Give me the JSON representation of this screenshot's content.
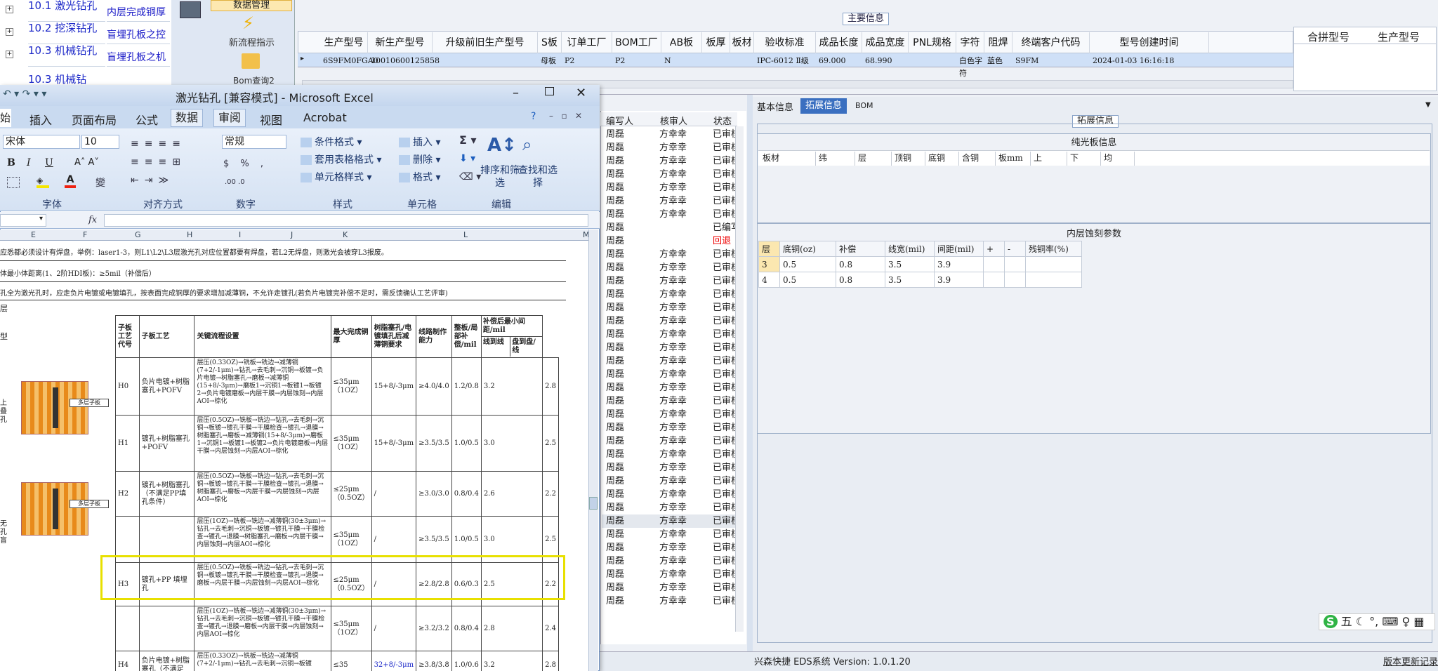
{
  "left_tree": {
    "items": [
      {
        "id": "10.1",
        "name": "激光钻孔",
        "desc": "内层完成铜厚"
      },
      {
        "id": "10.2",
        "name": "挖深钻孔",
        "desc": "盲埋孔板之控"
      },
      {
        "id": "10.3",
        "name": "机械钻孔",
        "desc": "盲埋孔板之机"
      },
      {
        "id": "10.3",
        "name": "机械钻",
        "desc": ""
      }
    ]
  },
  "toolbar_left": {
    "data_mgmt": "数据管理",
    "new_guide": "新流程指示",
    "bom_query": "Bom查询2"
  },
  "main_info": {
    "section_title": "主要信息",
    "columns": [
      "生产型号",
      "新生产型号",
      "升级前旧生产型号",
      "S板",
      "订单工厂",
      "BOM工厂",
      "AB板",
      "板厚",
      "板材",
      "验收标准",
      "成品长度",
      "成品宽度",
      "PNL规格",
      "字符",
      "阻焊",
      "终端客户代码",
      "型号创建时间"
    ],
    "row": [
      "6S9FM0FGA0",
      "10010600125858",
      "",
      "母板",
      "P2",
      "P2",
      "N",
      "",
      "",
      "IPC-6012 Ⅱ级",
      "69.000",
      "68.990",
      "",
      "白色字符",
      "蓝色",
      "S9FM",
      "2024-01-03 16:16:18"
    ],
    "side_columns": [
      "合拼型号",
      "生产型号"
    ]
  },
  "excel": {
    "title": "激光钻孔 [兼容模式] - Microsoft Excel",
    "tabs": [
      "始",
      "插入",
      "页面布局",
      "公式",
      "数据",
      "审阅",
      "视图",
      "Acrobat"
    ],
    "font_name": "宋体",
    "font_size": "10",
    "number_format": "常规",
    "groups": [
      "字体",
      "对齐方式",
      "数字",
      "样式",
      "单元格",
      "编辑"
    ],
    "style_btns": [
      "条件格式",
      "套用表格格式",
      "单元格样式"
    ],
    "cell_btns": [
      "插入",
      "删除",
      "格式"
    ],
    "edit_btns": [
      "排序和筛选",
      "查找和选择"
    ],
    "fx": "fx",
    "col_letters": [
      "E",
      "F",
      "G",
      "H",
      "I",
      "J",
      "K",
      "L",
      "M"
    ],
    "note1": "应悉都必须设计有焊盘，举例：laser1-3，则L1\\L2\\L3层激光孔对应位置都要有焊盘，若L2无焊盘，则激光会被穿L3报废。",
    "note2": "体最小体距离(1、2阶HDI板)：≥5mil（补偿后）",
    "note3": "孔全为激光孔时，应走负片电镀或电镀填孔，按表面完成铜厚的要求增加减薄铜，不允许走镀孔(若负片电镀完补偿不足时，需反馈确认工艺评审)",
    "note4": "层",
    "table_headers": [
      "子板工艺代号",
      "子板工艺",
      "关键流程设置",
      "最大完成铜厚",
      "树脂塞孔/电镀填孔后减薄铜要求",
      "线路制作能力",
      "整板/局部补偿/mil",
      "补偿后最小间距/mil",
      "线到线",
      "盘到盘/线"
    ],
    "rows": [
      {
        "code": "H0",
        "proc": "负片电镀+树脂塞孔+POFV",
        "flow": "层压(0.33OZ)→铣板→铣边→减薄铜(7+2/-1μm)→钻孔→去毛刺→沉铜→板镀→负片电镀→树脂塞孔→磨板→减薄铜(15+8/-3μm)→磨板1→沉铜1→板镀1→板镀2→负片电镀磨板→内层干膜→内层蚀刻→内层AOI→棕化",
        "cu": "≤35μm（1OZ）",
        "thin": "15+8/-3μm",
        "line": "≥4.0/4.0",
        "comp": "1.2/0.8",
        "ll": "3.2",
        "pp": "2.8"
      },
      {
        "code": "H1",
        "proc": "镀孔+树脂塞孔+POFV",
        "flow": "层压(0.5OZ)→铣板→铣边→钻孔→去毛刺→沉铜→板镀→镀孔干膜→干膜检查→镀孔→退膜→树脂塞孔→磨板→减薄铜(15+8/-3μm)→磨板1→沉铜1→板镀1→板镀2→负片电镀磨板→内层干膜→内层蚀刻→内层AOI→棕化",
        "cu": "≤35μm（1OZ）",
        "thin": "15+8/-3μm",
        "line": "≥3.5/3.5",
        "comp": "1.0/0.5",
        "ll": "3.0",
        "pp": "2.5"
      },
      {
        "code": "H2",
        "proc": "镀孔+树脂塞孔（不满足PP填孔条件）",
        "flow": "层压(0.5OZ)→铣板→铣边→钻孔→去毛刺→沉铜→板镀→镀孔干膜→干膜检查→镀孔→退膜→树脂塞孔→磨板→内层干膜→内层蚀刻→内层AOI→棕化",
        "cu": "≤25μm（0.5OZ）",
        "thin": "/",
        "line": "≥3.0/3.0",
        "comp": "0.8/0.4",
        "ll": "2.6",
        "pp": "2.2"
      },
      {
        "code": "",
        "proc": "",
        "flow": "层压(1OZ)→铣板→铣边→减薄铜(30±3μm)→钻孔→去毛刺→沉铜→板镀→镀孔干膜→干膜检查→镀孔→退膜→树脂塞孔→磨板→内层干膜→内层蚀刻→内层AOI→棕化",
        "cu": "≤35μm（1OZ）",
        "thin": "/",
        "line": "≥3.5/3.5",
        "comp": "1.0/0.5",
        "ll": "3.0",
        "pp": "2.5"
      },
      {
        "code": "H3",
        "proc": "镀孔+PP 填埋孔",
        "flow": "层压(0.5OZ)→铣板→铣边→钻孔→去毛刺→沉铜→板镀→镀孔干膜→干膜检查→镀孔→退膜→磨板→内层干膜→内层蚀刻→内层AOI→棕化",
        "cu": "≤25μm（0.5OZ）",
        "thin": "/",
        "line": "≥2.8/2.8",
        "comp": "0.6/0.3",
        "ll": "2.5",
        "pp": "2.2"
      },
      {
        "code": "",
        "proc": "",
        "flow": "层压(1OZ)→铣板→铣边→减薄铜(30±3μm)→钻孔→去毛刺→沉铜→板镀→镀孔干膜→干膜检查→镀孔→退膜→磨板→内层干膜→内层蚀刻→内层AOI→棕化",
        "cu": "≤35μm（1OZ）",
        "thin": "/",
        "line": "≥3.2/3.2",
        "comp": "0.8/0.4",
        "ll": "2.8",
        "pp": "2.4"
      },
      {
        "code": "H4",
        "proc": "负片电镀+树脂塞孔（不满足",
        "flow": "层压(0.33OZ)→铣板→铣边→减薄铜(7+2/-1μm)→钻孔→去毛刺→沉铜→板镀",
        "cu": "≤35",
        "thin": "32+8/-3μm",
        "line": "≥3.8/3.8",
        "comp": "1.0/0.6",
        "ll": "3.2",
        "pp": "2.8"
      }
    ],
    "img_label": "多层子板",
    "side_labels": [
      "上叠孔",
      "无孔盲"
    ]
  },
  "list": {
    "headers": [
      "编写人",
      "核审人",
      "状态"
    ],
    "rows": [
      [
        "周磊",
        "方幸幸",
        "已审核"
      ],
      [
        "周磊",
        "方幸幸",
        "已审核"
      ],
      [
        "周磊",
        "方幸幸",
        "已审核"
      ],
      [
        "周磊",
        "方幸幸",
        "已审核"
      ],
      [
        "周磊",
        "方幸幸",
        "已审核"
      ],
      [
        "周磊",
        "方幸幸",
        "已审核"
      ],
      [
        "周磊",
        "方幸幸",
        "已审核"
      ],
      [
        "周磊",
        "",
        "已编写"
      ],
      [
        "周磊",
        "",
        "回退"
      ],
      [
        "周磊",
        "方幸幸",
        "已审核"
      ],
      [
        "周磊",
        "方幸幸",
        "已审核"
      ],
      [
        "周磊",
        "方幸幸",
        "已审核"
      ],
      [
        "周磊",
        "方幸幸",
        "已审核"
      ],
      [
        "周磊",
        "方幸幸",
        "已审核"
      ],
      [
        "周磊",
        "方幸幸",
        "已审核"
      ],
      [
        "周磊",
        "方幸幸",
        "已审核"
      ],
      [
        "周磊",
        "方幸幸",
        "已审核"
      ],
      [
        "周磊",
        "方幸幸",
        "已审核"
      ],
      [
        "周磊",
        "方幸幸",
        "已审核"
      ],
      [
        "周磊",
        "方幸幸",
        "已审核"
      ],
      [
        "周磊",
        "方幸幸",
        "已审核"
      ],
      [
        "周磊",
        "方幸幸",
        "已审核"
      ],
      [
        "周磊",
        "方幸幸",
        "已审核"
      ],
      [
        "周磊",
        "方幸幸",
        "已审核"
      ],
      [
        "周磊",
        "方幸幸",
        "已审核"
      ],
      [
        "周磊",
        "方幸幸",
        "已审核"
      ],
      [
        "周磊",
        "方幸幸",
        "已审核"
      ],
      [
        "周磊",
        "方幸幸",
        "已审核"
      ],
      [
        "周磊",
        "方幸幸",
        "已审核"
      ],
      [
        "周磊",
        "方幸幸",
        "已审核"
      ],
      [
        "周磊",
        "方幸幸",
        "已审核"
      ],
      [
        "周磊",
        "方幸幸",
        "已审核"
      ],
      [
        "周磊",
        "方幸幸",
        "已审核"
      ],
      [
        "周磊",
        "方幸幸",
        "已审核"
      ],
      [
        "周磊",
        "方幸幸",
        "已审核"
      ],
      [
        "周磊",
        "方幸幸",
        "已审核"
      ]
    ]
  },
  "right_panel": {
    "tabs": [
      "基本信息",
      "拓展信息",
      "BOM"
    ],
    "section_title": "拓展信息",
    "pure_board_title": "纯光板信息",
    "pure_cols": [
      "板材",
      "纬",
      "层",
      "顶铜",
      "底铜",
      "含铜",
      "板mm",
      "上",
      "下",
      "均"
    ],
    "inner_title": "内层蚀刻参数",
    "inner_cols": [
      "层",
      "底铜(oz)",
      "补偿",
      "线宽(mil)",
      "间距(mil)",
      "+",
      "-",
      "残铜率(%)"
    ],
    "inner_rows": [
      [
        "3",
        "0.5",
        "0.8",
        "3.5",
        "3.9",
        "",
        "",
        ""
      ],
      [
        "4",
        "0.5",
        "0.8",
        "3.5",
        "3.9",
        "",
        "",
        ""
      ]
    ]
  },
  "status_bar": {
    "system": "兴森快捷 EDS系统 Version: 1.0.1.20",
    "update_log": "版本更新记录",
    "ime": "五"
  }
}
